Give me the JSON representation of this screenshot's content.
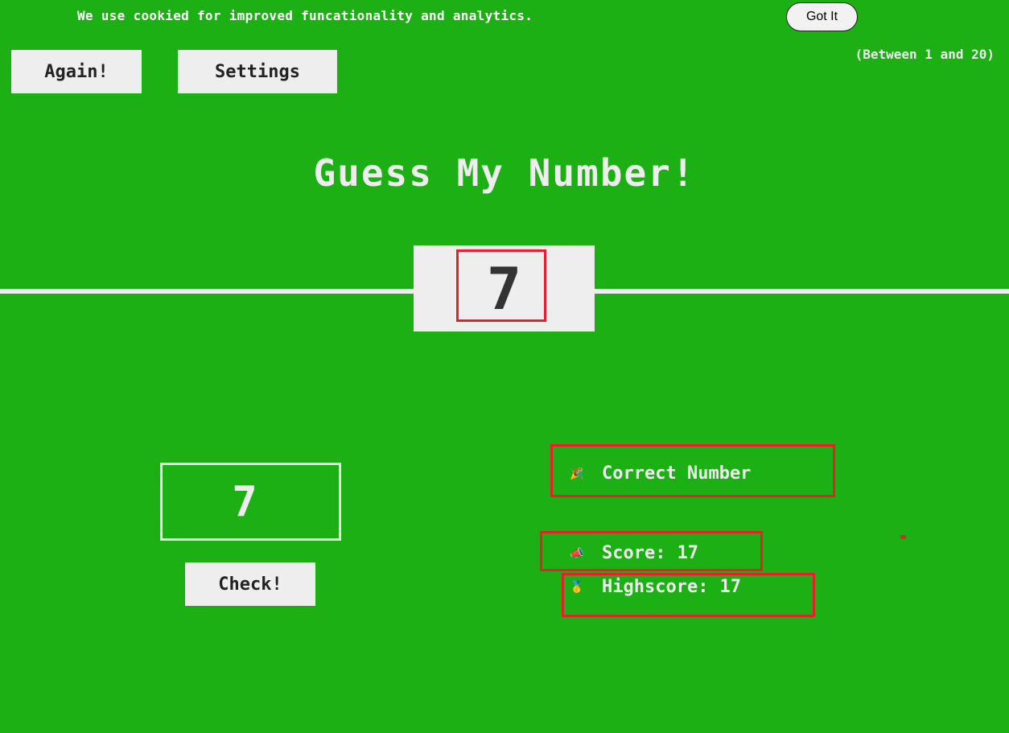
{
  "cookie_banner": {
    "text": "We use cookied for improved funcationality and analytics.",
    "button_label": "Got It"
  },
  "header": {
    "again_label": "Again!",
    "settings_label": "Settings",
    "range_hint": "(Between 1 and 20)"
  },
  "title": "Guess My Number!",
  "secret_number": "7",
  "guess": {
    "value": "7",
    "check_label": "Check!"
  },
  "stats": {
    "message": "Correct Number",
    "message_icon": "party-popper-icon",
    "score_label": "Score:",
    "score": "17",
    "score_icon": "megaphone-icon",
    "highscore_label": "Highscore:",
    "highscore": "17",
    "highscore_icon": "medal-icon"
  },
  "colors": {
    "background": "#1db015",
    "panel": "#eeeeee",
    "highlight": "#e8202a"
  }
}
